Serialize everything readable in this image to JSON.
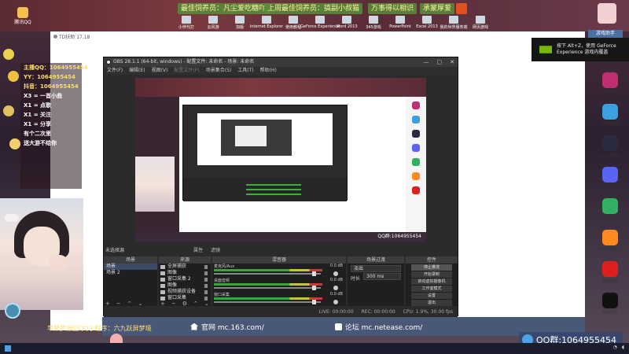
{
  "top": {
    "banners": [
      "最佳饲养员：凡尘爱吃糖吖",
      "上周最佳饲养员：搞副小叔猫",
      "万事得以相识",
      "承蒙厚爱"
    ],
    "desktop_icons": [
      "小伴代打",
      "云风游",
      "加版",
      "Internet Explorer",
      "使用教程",
      "GeForce Experience",
      "Word 2013",
      "345游戏",
      "PowerPoint",
      "Excel 2013",
      "我的世界服务端",
      "网页游戏"
    ],
    "left_tile": "腾讯QQ"
  },
  "stats": {
    "lines": [
      {
        "text": "主播QQ：1064955454",
        "white": false
      },
      {
        "text": "YY：1064955454",
        "white": false
      },
      {
        "text": "抖音：1064955454",
        "white": false
      },
      {
        "text": "X3 = 一首小曲",
        "white": true
      },
      {
        "text": "X1 = 点歌",
        "white": true
      },
      {
        "text": "X1 = 关注",
        "white": true
      },
      {
        "text": "X1 = 分享",
        "white": true
      },
      {
        "text": "有个二次里",
        "white": true
      },
      {
        "text": "送大游不给你",
        "white": true
      }
    ]
  },
  "page": {
    "title": "TD扶助 17.18"
  },
  "toast": {
    "line1": "按下 Alt+Z，使用 GeForce",
    "line2": "Experience 游戏内覆盖"
  },
  "watermark": "游戏助手",
  "dock": [
    {
      "label": "LetsVPN",
      "color": "#c03070"
    },
    {
      "label": "QQ浏览器",
      "color": "#3aa0e0"
    },
    {
      "label": "VsCode插件",
      "color": "#2a2a40"
    },
    {
      "label": "Discord",
      "color": "#5865f2"
    },
    {
      "label": "腾讯视频",
      "color": "#30b060"
    },
    {
      "label": "快手直播伴侣",
      "color": "#ff8a20"
    },
    {
      "label": "极速剪辑",
      "color": "#e02020"
    },
    {
      "label": "CapCut",
      "color": "#111111"
    }
  ],
  "obs": {
    "title": "OBS 28.1.1 (64-bit, windows) - 配置文件: 未命名 - 场景: 未命名",
    "menu": [
      "文件(F)",
      "编辑(E)",
      "视图(V)",
      "配置文件(P)",
      "场景集合(S)",
      "工具(T)",
      "帮助(H)"
    ],
    "menu_dim": [
      false,
      false,
      false,
      true,
      false,
      false,
      false
    ],
    "scene_label": "未选择源",
    "filter_props": "属性",
    "filter_filters": "滤镜",
    "heads": {
      "scenes": "场景",
      "sources": "来源",
      "mixer": "混音器",
      "transitions": "场景过渡",
      "controls": "控件"
    },
    "scenes": [
      {
        "name": "场景",
        "selected": true
      },
      {
        "name": "场景 2",
        "selected": false
      }
    ],
    "sources": [
      "全屏捕获",
      "图像",
      "窗口采集 2",
      "图像",
      "视频捕获设备",
      "窗口采集"
    ],
    "mixer": [
      {
        "name": "麦克风/Aux",
        "db": "0.0 dB",
        "knob": 0.96
      },
      {
        "name": "桌面音频",
        "db": "0.0 dB",
        "knob": 0.96
      },
      {
        "name": "窗口采集",
        "db": "0.0 dB",
        "knob": 0.96
      }
    ],
    "transition": {
      "type": "淡出",
      "duration_label": "时长",
      "duration": "300 ms"
    },
    "controls": [
      "停止推流",
      "开始录制",
      "启动虚拟摄像机",
      "工作室模式",
      "设置",
      "退出"
    ],
    "controls_active": 0,
    "status": [
      "LIVE: 00:00:00",
      "REC: 00:00:00",
      "CPU: 1.9%, 30.00 fps"
    ]
  },
  "links": {
    "site": "官网 mc.163.com/",
    "forum": "论坛 mc.netease.com/"
  },
  "scroll_text": "苹果梦源回QQ小程序：六九跃屏梦境",
  "qq": {
    "label": "QQ群:1064955454"
  },
  "preview_qq": "QQ群:1064955454"
}
